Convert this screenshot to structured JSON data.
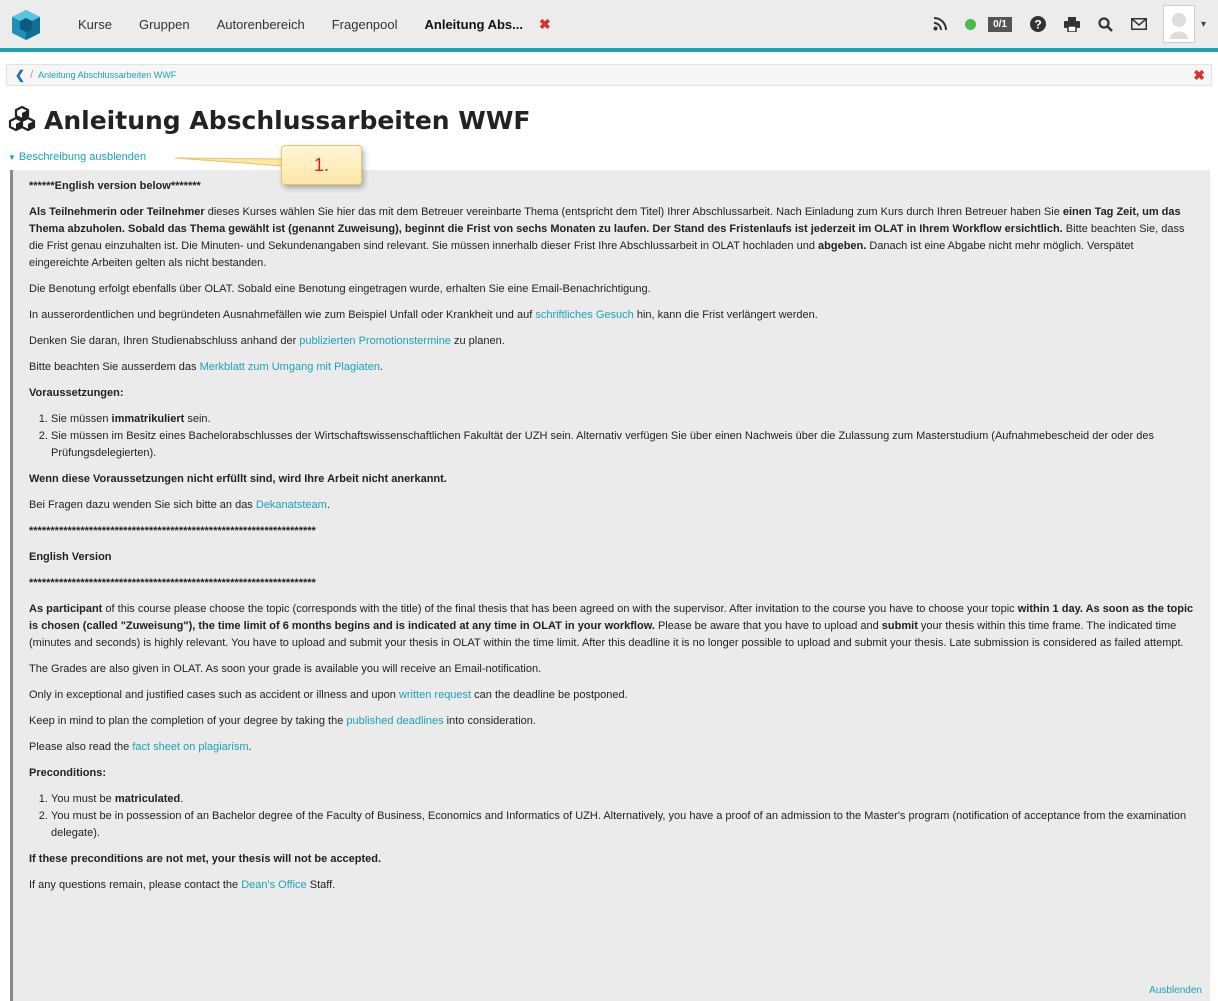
{
  "nav": {
    "items": [
      "Kurse",
      "Gruppen",
      "Autorenbereich",
      "Fragenpool"
    ],
    "active_tab": "Anleitung Abs...",
    "close_glyph": "✖",
    "counter": "0/1",
    "accent_color": "#1aa3b3"
  },
  "breadcrumb": {
    "back_glyph": "❮",
    "separator": "/",
    "link": "Anleitung Abschlussarbeiten WWF",
    "close_glyph": "✖"
  },
  "page": {
    "title": "Anleitung Abschlussarbeiten WWF",
    "toggle_label": "Beschreibung ausblenden",
    "callout": "1."
  },
  "content": {
    "english_marker": "******English version below*******",
    "de_p1_b1": "Als Teilnehmerin oder Teilnehmer",
    "de_p1_t1": " dieses Kurses wählen Sie hier das mit dem Betreuer vereinbarte Thema (entspricht dem Titel) Ihrer Abschlussarbeit. Nach Einladung zum Kurs durch Ihren Betreuer haben Sie ",
    "de_p1_b2": "einen Tag Zeit, um das Thema abzuholen. Sobald das Thema gewählt ist (genannt Zuweisung), beginnt die Frist von sechs Monaten zu laufen. Der Stand des Fristenlaufs ist jederzeit im OLAT in Ihrem Workflow ersichtlich.",
    "de_p1_t2": " Bitte beachten Sie, dass die Frist genau einzuhalten ist. Die Minuten- und Sekundenangaben sind relevant. Sie müssen innerhalb dieser Frist Ihre Abschlussarbeit in OLAT hochladen und ",
    "de_p1_b3": "abgeben.",
    "de_p1_t3": " Danach ist eine Abgabe nicht mehr möglich. Verspätet eingereichte Arbeiten gelten als nicht bestanden.",
    "de_p2": "Die Benotung erfolgt ebenfalls über OLAT. Sobald eine Benotung eingetragen wurde, erhalten Sie eine Email-Benachrichtigung.",
    "de_p3_t1": " In ausserordentlichen und begründeten Ausnahmefällen wie zum Beispiel Unfall oder Krankheit und auf ",
    "de_p3_link": "schriftliches Gesuch",
    "de_p3_t2": " hin, kann die Frist verlängert werden.",
    "de_p4_t1": " Denken Sie daran, Ihren Studienabschluss anhand der ",
    "de_p4_link": "publizierten Promotionstermine",
    "de_p4_t2": " zu planen.",
    "de_p5_t1": "Bitte beachten Sie ausserdem das ",
    "de_p5_link": "Merkblatt zum Umgang mit Plagiaten",
    "de_p5_t2": ".",
    "de_pre_heading": "Voraussetzungen:",
    "de_li1_t1": "Sie müssen ",
    "de_li1_b": "immatrikuliert",
    "de_li1_t2": " sein.",
    "de_li2": "Sie müssen im Besitz eines Bachelorabschlusses der Wirtschaftswissenschaftlichen Fakultät der UZH sein. Alternativ verfügen Sie über einen Nachweis über die Zulassung zum Masterstudium (Aufnahmebescheid der oder des Prüfungsdelegierten).",
    "de_warning": "Wenn diese Voraussetzungen nicht erfüllt sind, wird Ihre Arbeit nicht anerkannt.",
    "de_contact_t1": "Bei Fragen dazu wenden Sie sich bitte an das ",
    "de_contact_link": "Dekanatsteam",
    "de_contact_t2": ".",
    "stars": "*******************************************************************",
    "en_heading": "English Version",
    "en_p1_b1": "As participant",
    "en_p1_t1": " of this course please choose the topic (corresponds with the title) of the final thesis that has been agreed on with the supervisor. After invitation to the course you have to choose your topic ",
    "en_p1_b2": "within 1 day. As soon as the topic is chosen (called \"Zuweisung\"), the time limit of 6 months begins and is indicated at any time in OLAT in your workflow.",
    "en_p1_t2": " Please be aware that you have to upload and ",
    "en_p1_b3": "submit",
    "en_p1_t3": " your thesis within this time frame. The indicated time (minutes and seconds) is highly relevant. You have to upload and submit your thesis in OLAT within the time limit. After this deadline it is no longer possible to upload and submit your thesis. Late submission is considered as failed attempt.",
    "en_p2": "The Grades are also given in OLAT. As soon your grade is available you will receive an Email-notification.",
    "en_p3_t1": "Only in exceptional and justified cases such as accident or illness and upon ",
    "en_p3_link": "written request",
    "en_p3_t2": " can the deadline be postponed.",
    "en_p4_t1": "Keep in mind to plan the completion of your degree by taking the ",
    "en_p4_link": "published deadlines",
    "en_p4_t2": " into consideration.",
    "en_p5_t1": "Please also read the ",
    "en_p5_link": "fact sheet on plagiarism",
    "en_p5_t2": ".",
    "en_pre_heading": "Preconditions:",
    "en_li1_t1": "You must be ",
    "en_li1_b": "matriculated",
    "en_li1_t2": ".",
    "en_li2": "You must be in possession of an Bachelor degree of the Faculty of Business, Economics and Informatics of UZH. Alternatively, you have a proof of an admission to the Master's program (notification of acceptance from the examination delegate).",
    "en_warning": " If these preconditions are not met, your thesis will not be accepted.",
    "en_contact_t1": "If any questions remain, please contact the ",
    "en_contact_link": "Dean's Office",
    "en_contact_t2": " Staff.",
    "hide_link": "Ausblenden"
  }
}
